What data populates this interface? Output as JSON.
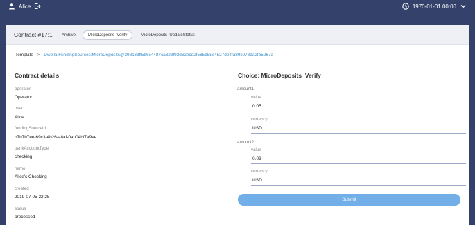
{
  "topbar": {
    "user_name": "Alice",
    "datetime": "1970-01-01 00:00"
  },
  "contract": {
    "title": "Contract #17:1",
    "tabs": [
      "Archive",
      "MicroDeposits_Verify",
      "MicroDeposits_UpdateStatus"
    ],
    "active_tab": "MicroDeposits_Verify"
  },
  "template": {
    "label": "Template",
    "separator": ">",
    "link": "Dwolla.FundingSources:MicroDeposits@398c38ff5b6c4487ca328f92d62ecd2f585d55c4527de4fa89c078da2fb5267a"
  },
  "details": {
    "title": "Contract details",
    "fields": [
      {
        "label": "operator",
        "value": "Operator"
      },
      {
        "label": "user",
        "value": "Alice"
      },
      {
        "label": "fundingSourceId",
        "value": "b7b7b7ee-69c3-4b26-a8af-0ab04bf7a9ee"
      },
      {
        "label": "bankAccountType",
        "value": "checking"
      },
      {
        "label": "name",
        "value": "Alice's Checking"
      },
      {
        "label": "created",
        "value": "2019-07-05 22:25"
      },
      {
        "label": "status",
        "value": "processed"
      }
    ]
  },
  "choice": {
    "title": "Choice: MicroDeposits_Verify",
    "amount1": {
      "label": "amount1",
      "value_label": "value",
      "value": "0.05",
      "currency_label": "currency",
      "currency": "USD"
    },
    "amount2": {
      "label": "amount2",
      "value_label": "value",
      "value": "0.03",
      "currency_label": "currency",
      "currency": "USD"
    },
    "submit_label": "Submit"
  },
  "colors": {
    "background": "#33416b",
    "link": "#3a90c9",
    "submit": "#72aee8"
  }
}
